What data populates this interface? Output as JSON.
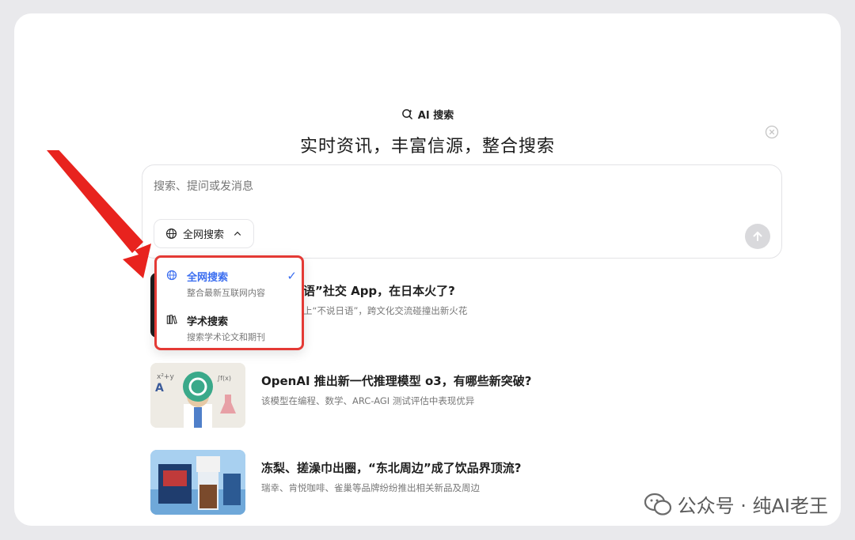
{
  "header": {
    "brand_label": "AI 搜索",
    "headline": "实时资讯，丰富信源，整合搜索"
  },
  "search": {
    "placeholder": "搜索、提问或发消息",
    "mode_label": "全网搜索"
  },
  "dropdown": {
    "options": [
      {
        "label": "全网搜索",
        "desc": "整合最新互联网内容",
        "icon": "globe-icon",
        "selected": true
      },
      {
        "label": "学术搜索",
        "desc": "搜索学术论文和期刊",
        "icon": "library-icon",
        "selected": false
      }
    ],
    "check": "✓"
  },
  "news": [
    {
      "title": "语”社交 App，在日本火了?",
      "subtitle": "上“不说日语”，跨文化交流碰撞出新火花"
    },
    {
      "title": "OpenAI 推出新一代推理模型 o3，有哪些新突破?",
      "subtitle": "该模型在编程、数学、ARC-AGI 测试评估中表现优异"
    },
    {
      "title": "冻梨、搓澡巾出圈，“东北周边”成了饮品界顶流?",
      "subtitle": "瑞幸、肯悦咖啡、雀巢等品牌纷纷推出相关新品及周边"
    }
  ],
  "watermark": {
    "text": "公众号 · 纯AI老王"
  },
  "colors": {
    "accent": "#3a6df0",
    "highlight_border": "#e43a35",
    "arrow": "#e8231e"
  }
}
